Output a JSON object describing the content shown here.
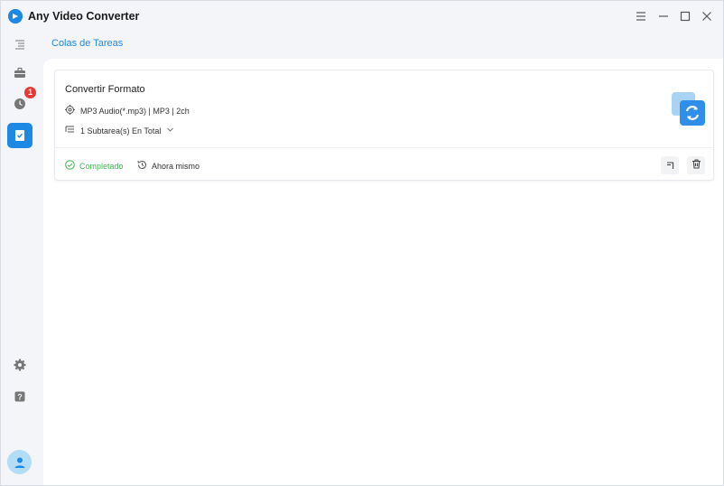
{
  "app": {
    "title": "Any Video Converter",
    "logo_icon": "app-logo-icon"
  },
  "window_controls": [
    "menu-icon",
    "minimize-icon",
    "maximize-icon",
    "close-icon"
  ],
  "sidebar": {
    "items": [
      {
        "icon": "collapse-menu-icon"
      },
      {
        "icon": "toolbox-icon"
      },
      {
        "icon": "history-clock-icon",
        "badge": "1"
      },
      {
        "icon": "task-queue-icon",
        "active": true
      },
      {
        "icon": "gear-icon"
      },
      {
        "icon": "help-icon"
      },
      {
        "icon": "user-avatar-icon"
      }
    ]
  },
  "header": {
    "title": "Colas de Tareas"
  },
  "task": {
    "title": "Convertir Formato",
    "format": "MP3 Audio(*.mp3) | MP3 | 2ch",
    "subtasks": "1 Subtarea(s) En Total",
    "status": "Completado",
    "time": "Ahora mismo"
  },
  "colors": {
    "accent": "#1e88e5",
    "success": "#3fb950",
    "badge": "#e53935"
  }
}
